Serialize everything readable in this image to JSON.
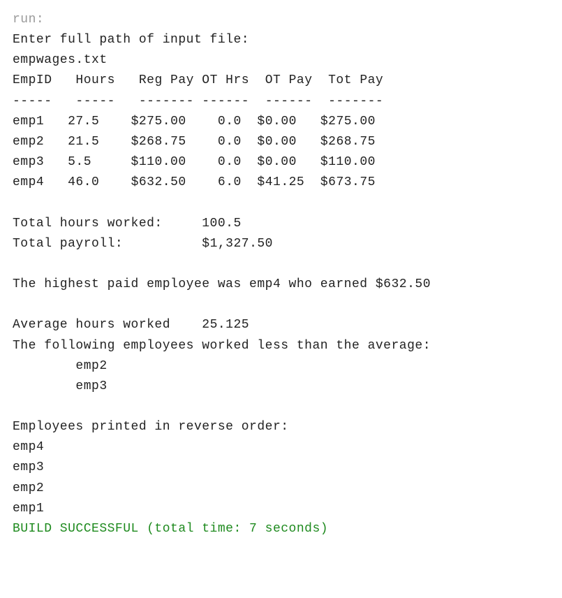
{
  "run_label": "run:",
  "prompts": {
    "enter_path": "Enter full path of input file:",
    "input_file": "empwages.txt"
  },
  "table": {
    "headers": [
      "EmpID",
      "Hours",
      "Reg Pay",
      "OT Hrs",
      "OT Pay",
      "Tot Pay"
    ],
    "sep": [
      "-----",
      "-----",
      "-------",
      "------",
      "------",
      "-------"
    ],
    "rows": [
      {
        "id": "emp1",
        "hours": "27.5",
        "reg": "$275.00",
        "ot_hrs": "0.0",
        "ot_pay": "$0.00",
        "tot": "$275.00"
      },
      {
        "id": "emp2",
        "hours": "21.5",
        "reg": "$268.75",
        "ot_hrs": "0.0",
        "ot_pay": "$0.00",
        "tot": "$268.75"
      },
      {
        "id": "emp3",
        "hours": "5.5",
        "reg": "$110.00",
        "ot_hrs": "0.0",
        "ot_pay": "$0.00",
        "tot": "$110.00"
      },
      {
        "id": "emp4",
        "hours": "46.0",
        "reg": "$632.50",
        "ot_hrs": "6.0",
        "ot_pay": "$41.25",
        "tot": "$673.75"
      }
    ]
  },
  "totals": {
    "hours_label": "Total hours worked:",
    "hours_value": "100.5",
    "payroll_label": "Total payroll:",
    "payroll_value": "$1,327.50"
  },
  "highest_paid_line": "The highest paid employee was emp4 who earned $632.50",
  "average": {
    "label": "Average hours worked",
    "value": "25.125",
    "below_label": "The following employees worked less than the average:",
    "below": [
      "emp2",
      "emp3"
    ]
  },
  "reverse": {
    "label": "Employees printed in reverse order:",
    "items": [
      "emp4",
      "emp3",
      "emp2",
      "emp1"
    ]
  },
  "build_msg": "BUILD SUCCESSFUL (total time: 7 seconds)"
}
